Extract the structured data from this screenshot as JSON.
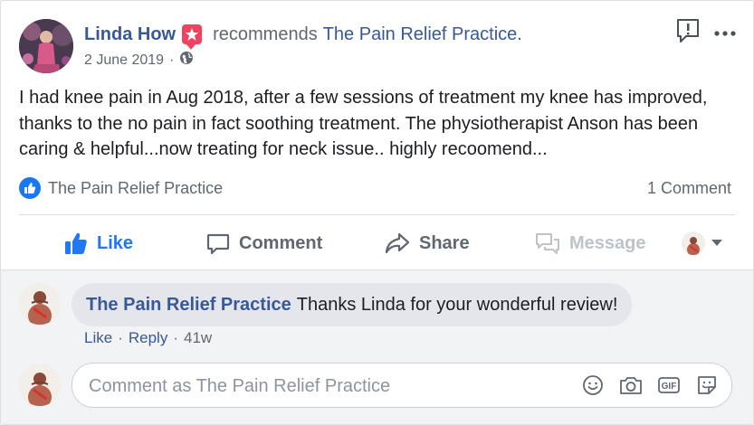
{
  "post": {
    "author_name": "Linda How",
    "recommends_text": "recommends",
    "page_name": "The Pain Relief Practice.",
    "date": "2 June 2019",
    "separator": "·",
    "body": "I had knee pain in Aug 2018, after a few sessions of treatment my knee has improved, thanks to the no pain in fact soothing treatment. The physiotherapist Anson has been caring & helpful...now treating for neck issue.. highly recoomend...",
    "reaction_name": "The Pain Relief Practice",
    "comment_count": "1 Comment"
  },
  "actions": {
    "like": "Like",
    "comment": "Comment",
    "share": "Share",
    "message": "Message"
  },
  "comments": [
    {
      "author": "The Pain Relief Practice",
      "text": "Thanks Linda for your wonderful review!",
      "like": "Like",
      "reply": "Reply",
      "time": "41w"
    }
  ],
  "composer": {
    "placeholder": "Comment as The Pain Relief Practice"
  },
  "icons": {
    "privacy": "globe-icon",
    "report": "report-icon",
    "more": "more-options-icon",
    "emoji": "emoji-icon",
    "camera": "camera-icon",
    "gif": "gif-icon",
    "sticker": "sticker-icon"
  },
  "colors": {
    "link": "#385898",
    "like_blue": "#2078f4",
    "badge_red": "#f3425f",
    "muted": "#606770",
    "disabled": "#bec3c9"
  }
}
